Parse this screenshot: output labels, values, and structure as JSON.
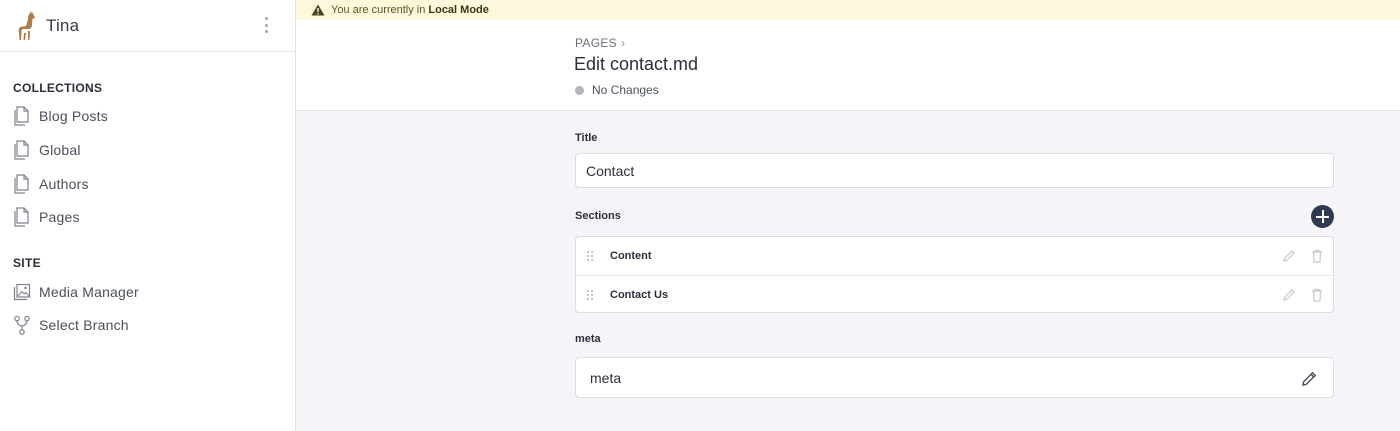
{
  "app": {
    "title": "Tina"
  },
  "banner": {
    "text": "You are currently in",
    "mode": "Local Mode"
  },
  "sidebar": {
    "collections_title": "COLLECTIONS",
    "collections": [
      {
        "label": "Blog Posts",
        "icon": "document-icon"
      },
      {
        "label": "Global",
        "icon": "document-icon"
      },
      {
        "label": "Authors",
        "icon": "document-icon"
      },
      {
        "label": "Pages",
        "icon": "document-icon"
      }
    ],
    "site_title": "SITE",
    "site": [
      {
        "label": "Media Manager",
        "icon": "media-icon"
      },
      {
        "label": "Select Branch",
        "icon": "branch-icon"
      }
    ]
  },
  "header": {
    "breadcrumb": "PAGES",
    "breadcrumb_sep": "›",
    "title": "Edit contact.md",
    "status": "No Changes"
  },
  "form": {
    "title_label": "Title",
    "title_value": "Contact",
    "sections_label": "Sections",
    "sections": [
      {
        "label": "Content"
      },
      {
        "label": "Contact Us"
      }
    ],
    "meta_label": "meta",
    "meta_value": "meta"
  }
}
